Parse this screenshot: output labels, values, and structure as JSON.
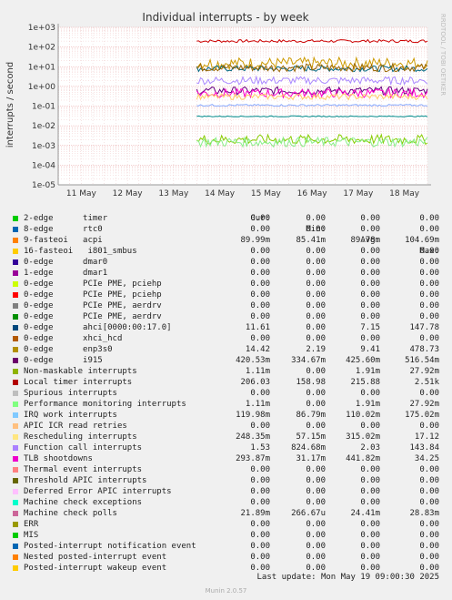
{
  "chart_data": {
    "type": "line",
    "title": "Individual interrupts - by week",
    "ylabel": "interrupts / second",
    "side_label": "RRDTOOL / TOBI OETIKER",
    "y_scale": "log",
    "ylim": [
      1e-05,
      1000
    ],
    "y_ticks": [
      "1e+03",
      "1e+02",
      "1e+01",
      "1e+00",
      "1e-01",
      "1e-02",
      "1e-03",
      "1e-04",
      "1e-05"
    ],
    "x_ticks": [
      "11 May",
      "12 May",
      "13 May",
      "14 May",
      "15 May",
      "16 May",
      "17 May",
      "18 May"
    ],
    "grid": true,
    "data_start": "14 May",
    "series": [
      {
        "name": "Local timer interrupts",
        "color": "#cc0000",
        "level": 200,
        "jitter": 0.15
      },
      {
        "name": "acpi",
        "color": "#cc9900",
        "level": 15,
        "jitter": 0.6
      },
      {
        "name": "ahci[0000:00:17.0]",
        "color": "#006680",
        "level": 8,
        "jitter": 0.3
      },
      {
        "name": "enp3s0",
        "color": "#996600",
        "level": 9,
        "jitter": 0.4
      },
      {
        "name": "i915",
        "color": "#660080",
        "level": 0.6,
        "jitter": 0.4
      },
      {
        "name": "Function call interrupts",
        "color": "#aa88ff",
        "level": 2,
        "jitter": 0.4
      },
      {
        "name": "TLB shootdowns",
        "color": "#ff00cc",
        "level": 0.45,
        "jitter": 0.45
      },
      {
        "name": "Rescheduling interrupts",
        "color": "#ffcc66",
        "level": 0.3,
        "jitter": 0.3
      },
      {
        "name": "IRQ work interrupts",
        "color": "#88aaff",
        "level": 0.11,
        "jitter": 0.1
      },
      {
        "name": "Machine check polls",
        "color": "#008888",
        "level": 0.03,
        "jitter": 0.05
      },
      {
        "name": "Non-maskable interrupts",
        "color": "#88cc00",
        "level": 0.002,
        "jitter": 0.5
      },
      {
        "name": "Performance monitoring interrupts",
        "color": "#88ee88",
        "level": 0.0015,
        "jitter": 0.5
      }
    ]
  },
  "legend": {
    "headers": {
      "cur": "Cur:",
      "min": "Min:",
      "avg": "Avg:",
      "max": "Max:"
    },
    "rows": [
      {
        "name": "2-edge      timer",
        "color": "#00cc00",
        "cur": "0.00",
        "min": "0.00",
        "avg": "0.00",
        "max": "0.00"
      },
      {
        "name": "8-edge      rtc0",
        "color": "#0066b3",
        "cur": "0.00",
        "min": "0.00",
        "avg": "0.00",
        "max": "0.00"
      },
      {
        "name": "9-fasteoi   acpi",
        "color": "#ff8000",
        "cur": "89.99m",
        "min": "85.41m",
        "avg": "89.78m",
        "max": "104.69m"
      },
      {
        "name": "16-fasteoi   i801_smbus",
        "color": "#ffcc00",
        "cur": "0.00",
        "min": "0.00",
        "avg": "0.00",
        "max": "0.00"
      },
      {
        "name": "0-edge      dmar0",
        "color": "#330099",
        "cur": "0.00",
        "min": "0.00",
        "avg": "0.00",
        "max": "0.00"
      },
      {
        "name": "1-edge      dmar1",
        "color": "#990099",
        "cur": "0.00",
        "min": "0.00",
        "avg": "0.00",
        "max": "0.00"
      },
      {
        "name": "0-edge      PCIe PME, pciehp",
        "color": "#ccff00",
        "cur": "0.00",
        "min": "0.00",
        "avg": "0.00",
        "max": "0.00"
      },
      {
        "name": "0-edge      PCIe PME, pciehp",
        "color": "#ff0000",
        "cur": "0.00",
        "min": "0.00",
        "avg": "0.00",
        "max": "0.00"
      },
      {
        "name": "0-edge      PCIe PME, aerdrv",
        "color": "#808080",
        "cur": "0.00",
        "min": "0.00",
        "avg": "0.00",
        "max": "0.00"
      },
      {
        "name": "0-edge      PCIe PME, aerdrv",
        "color": "#008f00",
        "cur": "0.00",
        "min": "0.00",
        "avg": "0.00",
        "max": "0.00"
      },
      {
        "name": "0-edge      ahci[0000:00:17.0]",
        "color": "#00487d",
        "cur": "11.61",
        "min": "0.00",
        "avg": "7.15",
        "max": "147.78"
      },
      {
        "name": "0-edge      xhci_hcd",
        "color": "#b35a00",
        "cur": "0.00",
        "min": "0.00",
        "avg": "0.00",
        "max": "0.00"
      },
      {
        "name": "0-edge      enp3s0",
        "color": "#b38f00",
        "cur": "14.42",
        "min": "2.19",
        "avg": "9.41",
        "max": "478.73"
      },
      {
        "name": "0-edge      i915",
        "color": "#6b006b",
        "cur": "420.53m",
        "min": "334.67m",
        "avg": "425.60m",
        "max": "516.54m"
      },
      {
        "name": "Non-maskable interrupts",
        "color": "#8fb300",
        "cur": "1.11m",
        "min": "0.00",
        "avg": "1.91m",
        "max": "27.92m"
      },
      {
        "name": "Local timer interrupts",
        "color": "#b30000",
        "cur": "206.03",
        "min": "158.98",
        "avg": "215.88",
        "max": "2.51k"
      },
      {
        "name": "Spurious interrupts",
        "color": "#bebebe",
        "cur": "0.00",
        "min": "0.00",
        "avg": "0.00",
        "max": "0.00"
      },
      {
        "name": "Performance monitoring interrupts",
        "color": "#80ff80",
        "cur": "1.11m",
        "min": "0.00",
        "avg": "1.91m",
        "max": "27.92m"
      },
      {
        "name": "IRQ work interrupts",
        "color": "#80c9ff",
        "cur": "119.98m",
        "min": "86.79m",
        "avg": "110.02m",
        "max": "175.02m"
      },
      {
        "name": "APIC ICR read retries",
        "color": "#ffc080",
        "cur": "0.00",
        "min": "0.00",
        "avg": "0.00",
        "max": "0.00"
      },
      {
        "name": "Rescheduling interrupts",
        "color": "#ffe680",
        "cur": "248.35m",
        "min": "57.15m",
        "avg": "315.02m",
        "max": "17.12"
      },
      {
        "name": "Function call interrupts",
        "color": "#aa80ff",
        "cur": "1.53",
        "min": "824.68m",
        "avg": "2.03",
        "max": "143.84"
      },
      {
        "name": "TLB shootdowns",
        "color": "#ee00cc",
        "cur": "293.87m",
        "min": "31.17m",
        "avg": "441.82m",
        "max": "34.25"
      },
      {
        "name": "Thermal event interrupts",
        "color": "#ff8080",
        "cur": "0.00",
        "min": "0.00",
        "avg": "0.00",
        "max": "0.00"
      },
      {
        "name": "Threshold APIC interrupts",
        "color": "#666600",
        "cur": "0.00",
        "min": "0.00",
        "avg": "0.00",
        "max": "0.00"
      },
      {
        "name": "Deferred Error APIC interrupts",
        "color": "#ffbfff",
        "cur": "0.00",
        "min": "0.00",
        "avg": "0.00",
        "max": "0.00"
      },
      {
        "name": "Machine check exceptions",
        "color": "#00ffcc",
        "cur": "0.00",
        "min": "0.00",
        "avg": "0.00",
        "max": "0.00"
      },
      {
        "name": "Machine check polls",
        "color": "#cc6699",
        "cur": "21.89m",
        "min": "266.67u",
        "avg": "24.41m",
        "max": "28.83m"
      },
      {
        "name": "ERR",
        "color": "#999900",
        "cur": "0.00",
        "min": "0.00",
        "avg": "0.00",
        "max": "0.00"
      },
      {
        "name": "MIS",
        "color": "#00cc00",
        "cur": "0.00",
        "min": "0.00",
        "avg": "0.00",
        "max": "0.00"
      },
      {
        "name": "Posted-interrupt notification event",
        "color": "#0066b3",
        "cur": "0.00",
        "min": "0.00",
        "avg": "0.00",
        "max": "0.00"
      },
      {
        "name": "Nested posted-interrupt event",
        "color": "#ff8000",
        "cur": "0.00",
        "min": "0.00",
        "avg": "0.00",
        "max": "0.00"
      },
      {
        "name": "Posted-interrupt wakeup event",
        "color": "#ffcc00",
        "cur": "0.00",
        "min": "0.00",
        "avg": "0.00",
        "max": "0.00"
      }
    ]
  },
  "last_update": "Last update: Mon May 19 09:00:30 2025",
  "footer": "Munin 2.0.57"
}
